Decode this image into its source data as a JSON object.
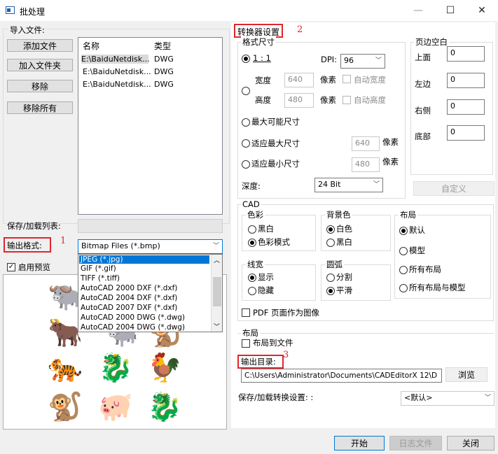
{
  "window": {
    "title": "批处理",
    "min": "—",
    "max": "☐",
    "close": "✕"
  },
  "import": {
    "label": "导入文件:",
    "buttons": {
      "add_file": "添加文件",
      "add_folder": "加入文件夹",
      "remove": "移除",
      "remove_all": "移除所有"
    },
    "columns": {
      "name": "名称",
      "type": "类型"
    },
    "files": [
      {
        "name": "E:\\BaiduNetdisk...",
        "type": "DWG"
      },
      {
        "name": "E:\\BaiduNetdisk...",
        "type": "DWG"
      },
      {
        "name": "E:\\BaiduNetdisk...",
        "type": "DWG"
      }
    ]
  },
  "save_load_list": {
    "label": "保存/加载列表:",
    "value": ""
  },
  "output_format": {
    "label": "输出格式:",
    "annotation": "1",
    "value": "Bitmap Files (*.bmp)",
    "options": [
      "JPEG (*.jpg)",
      "GIF (*.gif)",
      "TIFF (*.tiff)",
      "AutoCAD 2000 DXF (*.dxf)",
      "AutoCAD 2004 DXF (*.dxf)",
      "AutoCAD 2007 DXF (*.dxf)",
      "AutoCAD 2000 DWG (*.dwg)",
      "AutoCAD 2004 DWG (*.dwg)"
    ]
  },
  "preview": {
    "label": "启用预览",
    "checked": true
  },
  "converter": {
    "title": "转换器设置",
    "annotation": "2",
    "format_size": {
      "label": "格式尺寸",
      "ratio": "1 : 1",
      "dpi_label": "DPI:",
      "dpi_value": "96",
      "width_label": "宽度",
      "width_value": "640",
      "height_label": "高度",
      "height_value": "480",
      "pixel": "像素",
      "auto_width": "自动宽度",
      "auto_height": "自动高度",
      "max_size": "最大可能尺寸",
      "fit_max": "适应最大尺寸",
      "fit_max_value": "640",
      "fit_min": "适应最小尺寸",
      "fit_min_value": "480",
      "depth_label": "深度:",
      "depth_value": "24 Bit"
    },
    "margins": {
      "label": "页边空白",
      "top": "上面",
      "top_value": "0",
      "left": "左边",
      "left_value": "0",
      "right": "右侧",
      "right_value": "0",
      "bottom": "底部",
      "bottom_value": "0",
      "custom": "自定义"
    },
    "cad": {
      "label": "CAD",
      "color_label": "色彩",
      "bw": "黑白",
      "color_mode": "色彩模式",
      "bg_label": "背景色",
      "white": "白色",
      "black": "黑白",
      "layout_label": "布局",
      "default": "默认",
      "model": "模型",
      "all_layouts": "所有布局",
      "all_layouts_model": "所有布局与模型",
      "linewidth_label": "线宽",
      "show": "显示",
      "hide": "隐藏",
      "arc_label": "圆弧",
      "split": "分割",
      "smooth": "平滑",
      "pdf_as_image": "PDF 页面作为图像"
    },
    "layout2": {
      "label": "布局",
      "layout_to_file": "布局到文件"
    }
  },
  "output_dir": {
    "label": "输出目录:",
    "annotation": "3",
    "path": "C:\\Users\\Administrator\\Documents\\CADEditorX 12\\D",
    "browse": "浏览"
  },
  "save_load_settings": {
    "label": "保存/加载转换设置: :",
    "value": "<默认>"
  },
  "footer": {
    "start": "开始",
    "log": "日志文件",
    "close": "关闭"
  },
  "preview_glyphs": [
    "🐃",
    "🐂",
    "🐃",
    "🐒",
    "🐅",
    "🐉",
    "🐓",
    "🐒",
    "🐖",
    "🐉",
    "🐒"
  ],
  "colors": {
    "annotation_red": "#e0262c",
    "selection_blue": "#0078d7"
  }
}
